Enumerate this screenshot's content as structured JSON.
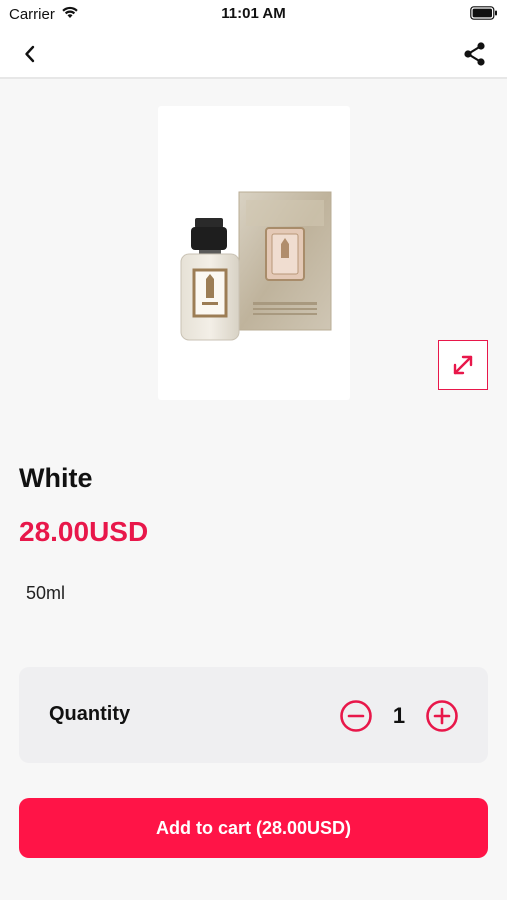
{
  "status_bar": {
    "carrier": "Carrier",
    "time": "11:01 AM",
    "wifi_icon": "wifi-icon",
    "battery_icon": "battery-icon"
  },
  "nav": {
    "back_icon": "chevron-left-icon",
    "share_icon": "share-icon"
  },
  "product": {
    "name": "White",
    "price": "28.00USD",
    "size": "50ml",
    "image_icon": "perfume-bottle-image"
  },
  "quantity": {
    "label": "Quantity",
    "value": "1",
    "minus_icon": "minus-circle-icon",
    "plus_icon": "plus-circle-icon"
  },
  "cart": {
    "button_label": "Add to cart (28.00USD)"
  },
  "colors": {
    "accent": "#e8174a",
    "button": "#ff1447",
    "background": "#f7f7f7",
    "card": "#efeff1"
  }
}
